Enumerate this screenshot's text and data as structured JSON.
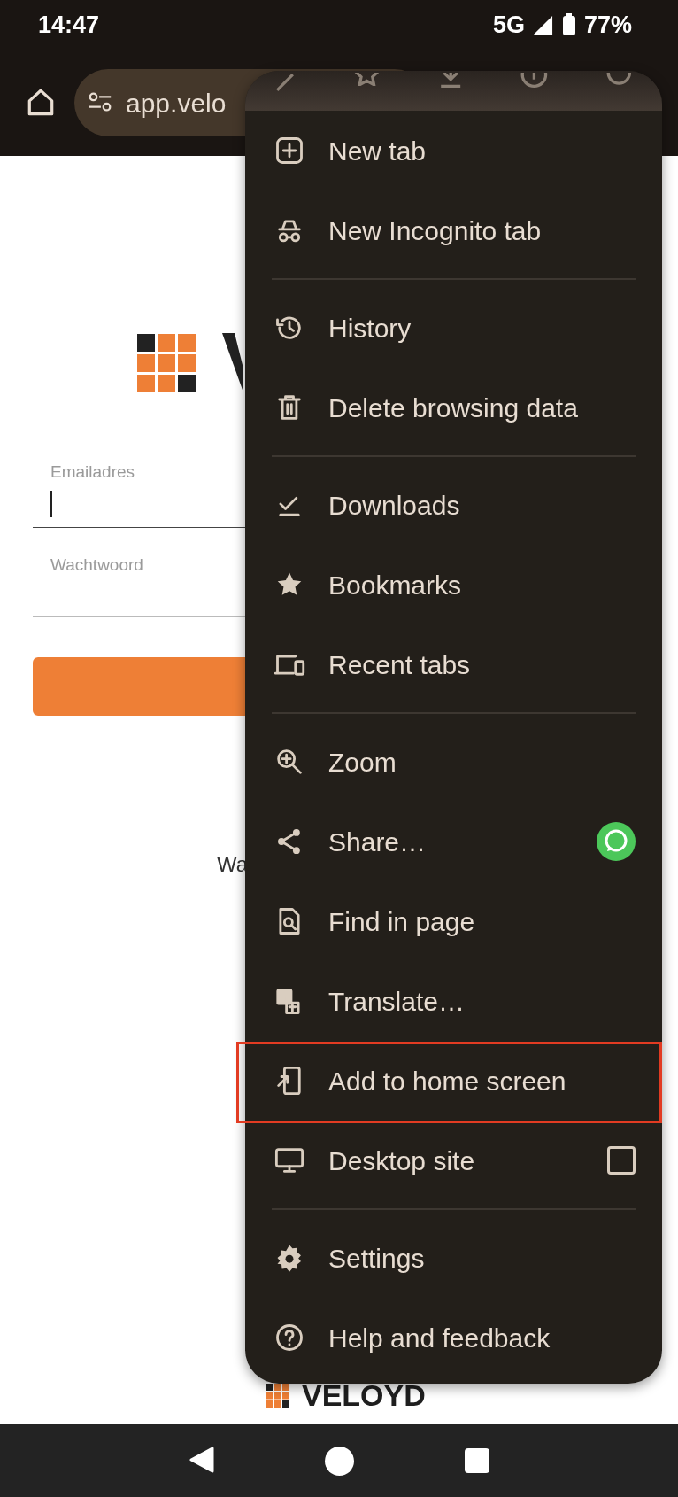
{
  "status_bar": {
    "time": "14:47",
    "network": "5G",
    "battery": "77%"
  },
  "toolbar": {
    "url": "app.velo"
  },
  "page": {
    "email_label": "Emailadres",
    "password_label": "Wachtwoord",
    "partial_text": "Wa",
    "footer_logo": "VELOYD"
  },
  "menu": {
    "groups": [
      [
        {
          "label": "New tab",
          "kind": "plain",
          "highlighted": false
        },
        {
          "label": "New Incognito tab",
          "kind": "plain",
          "highlighted": false
        }
      ],
      [
        {
          "label": "History",
          "kind": "plain",
          "highlighted": false
        },
        {
          "label": "Delete browsing data",
          "kind": "plain",
          "highlighted": false
        }
      ],
      [
        {
          "label": "Downloads",
          "kind": "plain",
          "highlighted": false
        },
        {
          "label": "Bookmarks",
          "kind": "plain",
          "highlighted": false
        },
        {
          "label": "Recent tabs",
          "kind": "plain",
          "highlighted": false
        }
      ],
      [
        {
          "label": "Zoom",
          "kind": "plain",
          "highlighted": false
        },
        {
          "label": "Share…",
          "kind": "share",
          "highlighted": false
        },
        {
          "label": "Find in page",
          "kind": "plain",
          "highlighted": false
        },
        {
          "label": "Translate…",
          "kind": "plain",
          "highlighted": false
        },
        {
          "label": "Add to home screen",
          "kind": "plain",
          "highlighted": true
        },
        {
          "label": "Desktop site",
          "kind": "checkbox",
          "checked": false,
          "highlighted": false
        }
      ],
      [
        {
          "label": "Settings",
          "kind": "plain",
          "highlighted": false
        },
        {
          "label": "Help and feedback",
          "kind": "plain",
          "highlighted": false
        }
      ]
    ]
  }
}
